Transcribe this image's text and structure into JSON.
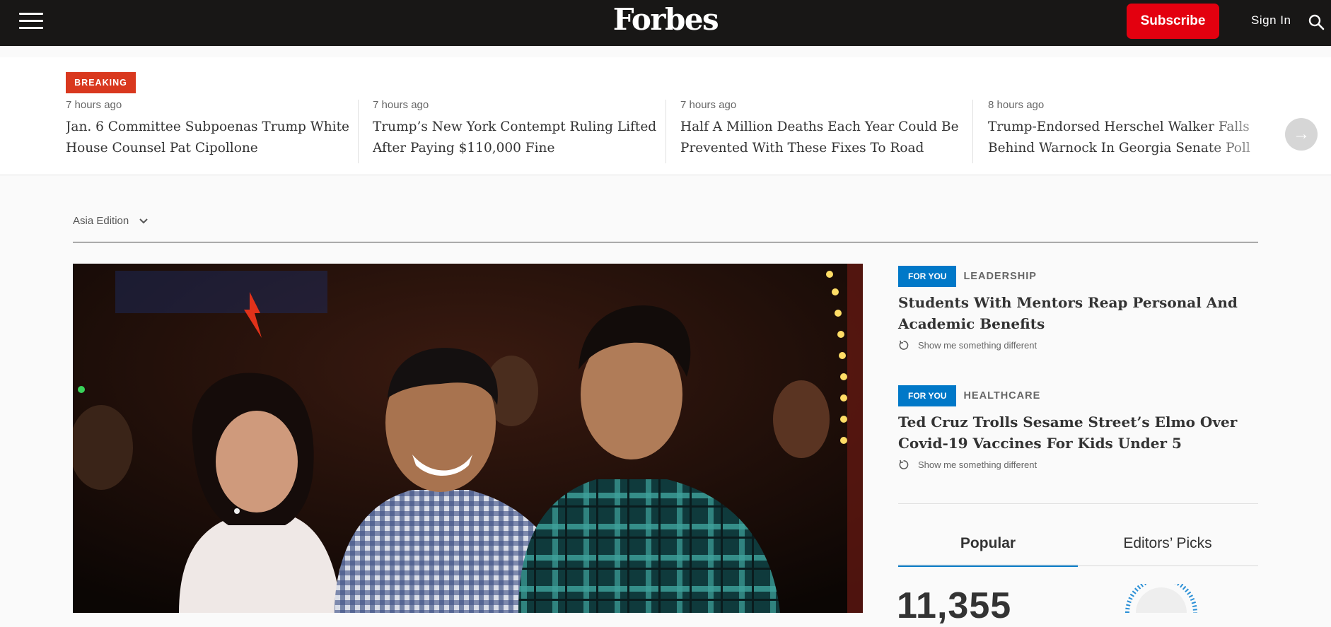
{
  "header": {
    "logo": "Forbes",
    "subscribe_label": "Subscribe",
    "signin_label": "Sign In"
  },
  "breaking": {
    "tag": "BREAKING",
    "items": [
      {
        "time": "7 hours ago",
        "headline": "Jan. 6 Committee Subpoenas Trump White House Counsel Pat Cipollone"
      },
      {
        "time": "7 hours ago",
        "headline": "Trump’s New York Contempt Ruling Lifted After Paying $110,000 Fine"
      },
      {
        "time": "7 hours ago",
        "headline": "Half A Million Deaths Each Year Could Be Prevented With These Fixes To Road Safety..."
      },
      {
        "time": "8 hours ago",
        "headline": "Trump-Endorsed Herschel Walker Falls Behind Warnock In Georgia Senate Poll"
      }
    ]
  },
  "edition": {
    "label": "Asia Edition"
  },
  "recommendations": [
    {
      "tag": "FOR YOU",
      "category": "LEADERSHIP",
      "title": "Students With Mentors Reap Personal And Academic Benefits",
      "action": "Show me something different"
    },
    {
      "tag": "FOR YOU",
      "category": "HEALTHCARE",
      "title": "Ted Cruz Trolls Sesame Street’s Elmo Over Covid-19 Vaccines For Kids Under 5",
      "action": "Show me something different"
    }
  ],
  "tabs": {
    "popular": "Popular",
    "editors": "Editors’ Picks"
  },
  "popular": {
    "count": "11,355"
  },
  "colors": {
    "header_bg": "#181716",
    "subscribe": "#e3000f",
    "breaking": "#d9381e",
    "accent_blue": "#0078c8"
  }
}
